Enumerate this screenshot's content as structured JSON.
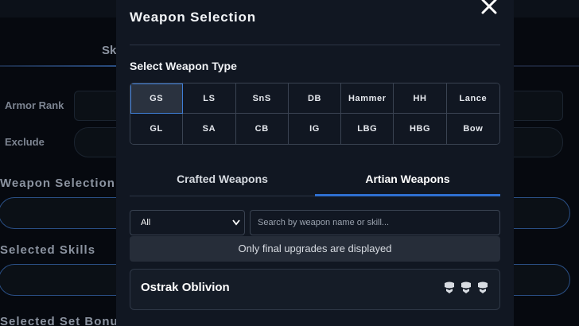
{
  "background": {
    "tab_partial": "Sk",
    "armor_rank_label": "Armor Rank",
    "exclude_label": "Exclude",
    "weapon_selection_label": "Weapon Selection",
    "selected_skills_label": "Selected Skills",
    "selected_set_bonus_label": "Selected Set Bonu"
  },
  "modal": {
    "title": "Weapon Selection",
    "close_icon": "close-icon",
    "select_type_label": "Select Weapon Type",
    "weapon_types": [
      "GS",
      "LS",
      "SnS",
      "DB",
      "Hammer",
      "HH",
      "Lance",
      "GL",
      "SA",
      "CB",
      "IG",
      "LBG",
      "HBG",
      "Bow"
    ],
    "selected_type": "GS",
    "tabs": {
      "crafted": "Crafted Weapons",
      "artian": "Artian Weapons",
      "active": "Artian Weapons"
    },
    "filter": {
      "selected": "All"
    },
    "search": {
      "placeholder": "Search by weapon name or skill..."
    },
    "notice": "Only final upgrades are displayed",
    "weapons": [
      {
        "name": "Ostrak Oblivion",
        "slots": [
          "decoration-slot-icon",
          "decoration-slot-icon",
          "decoration-slot-icon"
        ]
      }
    ]
  },
  "colors": {
    "accent": "#2f6fd0",
    "modal_bg": "#111722",
    "page_bg": "#06090f"
  }
}
